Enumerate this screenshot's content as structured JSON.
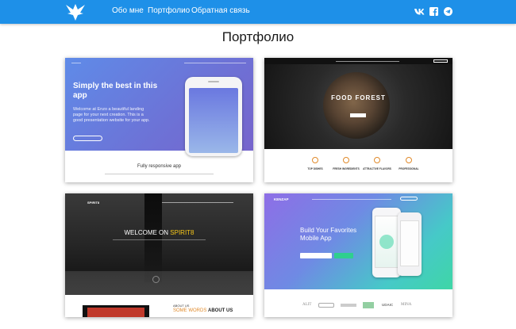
{
  "nav": {
    "links": [
      "Обо мне",
      "Портфолио",
      "Обратная связь"
    ],
    "social": [
      "vk-icon",
      "facebook-icon",
      "telegram-icon"
    ]
  },
  "page_title": "Портфолио",
  "portfolio": [
    {
      "heading": "Simply the best in this app",
      "body": "Welcome at Enzo a beautiful landing page for your next creation. This is a good presentation website for your app.",
      "feature": "Fully responsive app"
    },
    {
      "heading": "FOOD FOREST",
      "features": [
        "TOP DISHES",
        "FRESH INGREDIENTS",
        "ATTRACTIVE FLAVORS",
        "PROFESSIONAL"
      ]
    },
    {
      "brand": "SPIRIT8",
      "heading_prefix": "WELCOME ON ",
      "heading_accent": "SPIRIT8",
      "about_label": "ABOUT US",
      "about_prefix": "SOME WORDS ",
      "about_accent": "ABOUT US"
    },
    {
      "brand": "KENZAP",
      "heading": "Build Your Favorites Mobile App",
      "partners": [
        "ALIT",
        "UDAIC",
        "MINA"
      ]
    }
  ]
}
